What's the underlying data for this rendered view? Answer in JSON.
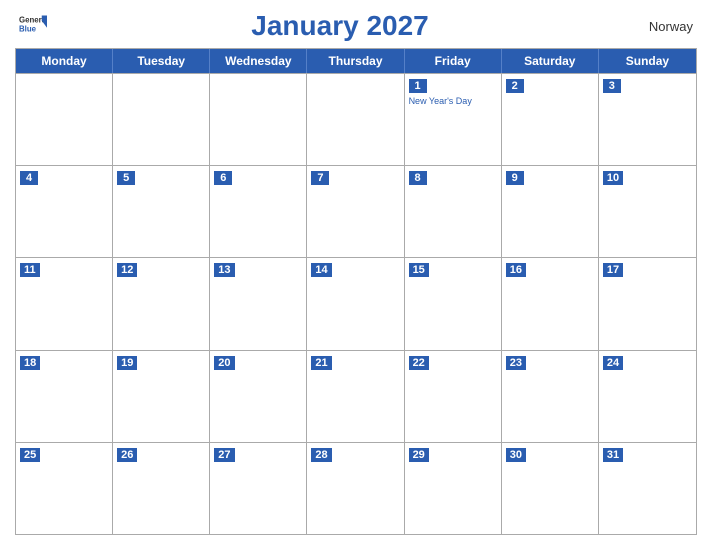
{
  "header": {
    "logo_general": "General",
    "logo_blue": "Blue",
    "title": "January 2027",
    "country": "Norway"
  },
  "days": [
    "Monday",
    "Tuesday",
    "Wednesday",
    "Thursday",
    "Friday",
    "Saturday",
    "Sunday"
  ],
  "weeks": [
    [
      {
        "date": "",
        "holiday": ""
      },
      {
        "date": "",
        "holiday": ""
      },
      {
        "date": "",
        "holiday": ""
      },
      {
        "date": "",
        "holiday": ""
      },
      {
        "date": "1",
        "holiday": "New Year's Day"
      },
      {
        "date": "2",
        "holiday": ""
      },
      {
        "date": "3",
        "holiday": ""
      }
    ],
    [
      {
        "date": "4",
        "holiday": ""
      },
      {
        "date": "5",
        "holiday": ""
      },
      {
        "date": "6",
        "holiday": ""
      },
      {
        "date": "7",
        "holiday": ""
      },
      {
        "date": "8",
        "holiday": ""
      },
      {
        "date": "9",
        "holiday": ""
      },
      {
        "date": "10",
        "holiday": ""
      }
    ],
    [
      {
        "date": "11",
        "holiday": ""
      },
      {
        "date": "12",
        "holiday": ""
      },
      {
        "date": "13",
        "holiday": ""
      },
      {
        "date": "14",
        "holiday": ""
      },
      {
        "date": "15",
        "holiday": ""
      },
      {
        "date": "16",
        "holiday": ""
      },
      {
        "date": "17",
        "holiday": ""
      }
    ],
    [
      {
        "date": "18",
        "holiday": ""
      },
      {
        "date": "19",
        "holiday": ""
      },
      {
        "date": "20",
        "holiday": ""
      },
      {
        "date": "21",
        "holiday": ""
      },
      {
        "date": "22",
        "holiday": ""
      },
      {
        "date": "23",
        "holiday": ""
      },
      {
        "date": "24",
        "holiday": ""
      }
    ],
    [
      {
        "date": "25",
        "holiday": ""
      },
      {
        "date": "26",
        "holiday": ""
      },
      {
        "date": "27",
        "holiday": ""
      },
      {
        "date": "28",
        "holiday": ""
      },
      {
        "date": "29",
        "holiday": ""
      },
      {
        "date": "30",
        "holiday": ""
      },
      {
        "date": "31",
        "holiday": ""
      }
    ]
  ]
}
